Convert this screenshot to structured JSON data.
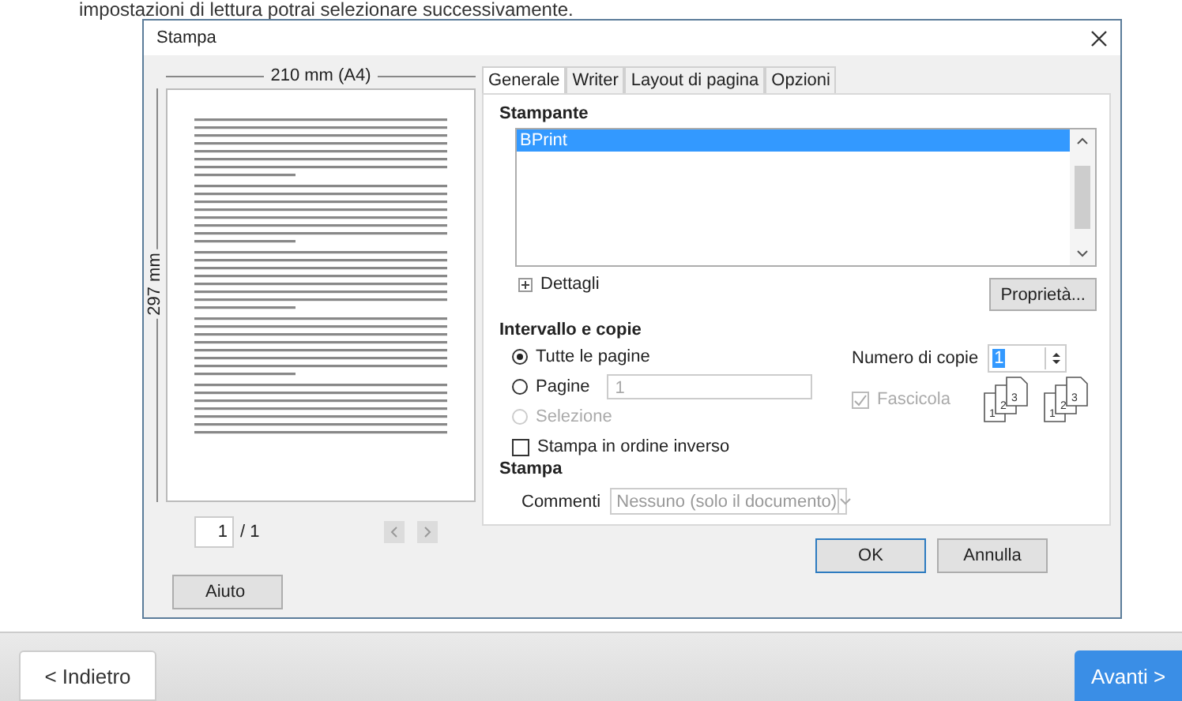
{
  "intro_text": "impostazioni di lettura potrai selezionare successivamente.",
  "dialog": {
    "title": "Stampa",
    "preview": {
      "width_label": "210 mm (A4)",
      "height_label": "297 mm",
      "page_input": "1",
      "page_total": "/ 1"
    },
    "tabs": [
      {
        "label": "Generale",
        "selected": true
      },
      {
        "label": "Writer",
        "selected": false
      },
      {
        "label": "Layout di pagina",
        "selected": false
      },
      {
        "label": "Opzioni",
        "selected": false
      }
    ],
    "printer_section": {
      "heading": "Stampante",
      "printers": [
        {
          "name": "BPrint",
          "selected": true
        }
      ],
      "details": "Dettagli",
      "details_expanded": false,
      "properties_button": "Proprietà..."
    },
    "range_section": {
      "heading": "Intervallo e copie",
      "options": [
        {
          "label": "Tutte le pagine",
          "selected": true,
          "disabled": false
        },
        {
          "label": "Pagine",
          "selected": false,
          "disabled": false,
          "value": "1"
        },
        {
          "label": "Selezione",
          "selected": false,
          "disabled": true
        }
      ],
      "reverse": {
        "label": "Stampa in ordine inverso",
        "checked": false
      },
      "copies_label": "Numero di copie",
      "copies_value": "1",
      "collate": {
        "label": "Fascicola",
        "checked": true,
        "disabled": true
      },
      "collate_icons": [
        {
          "pages": [
            "1",
            "2",
            "3"
          ]
        },
        {
          "pages": [
            "1",
            "2",
            "3"
          ]
        }
      ]
    },
    "print_section": {
      "heading": "Stampa",
      "comments_label": "Commenti",
      "comments_value": "Nessuno (solo il documento)"
    },
    "buttons": [
      {
        "label": "Aiuto",
        "kind": "help"
      },
      {
        "label": "OK",
        "kind": "default"
      },
      {
        "label": "Annulla",
        "kind": "normal"
      }
    ]
  },
  "nav": {
    "back": "< Indietro",
    "next": "Avanti >"
  }
}
